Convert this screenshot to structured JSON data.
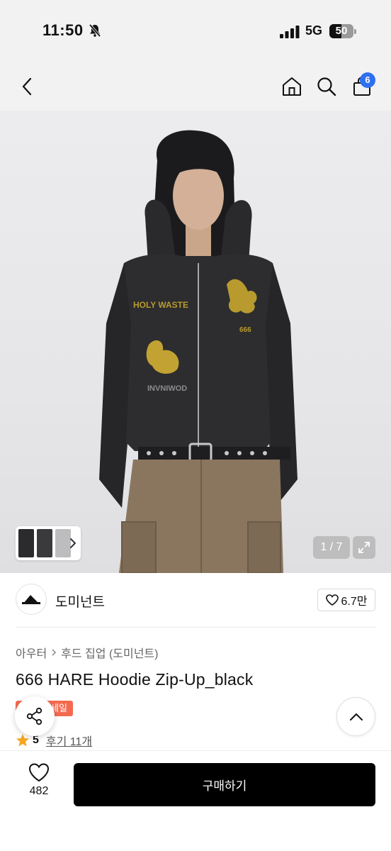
{
  "status_bar": {
    "time": "11:50",
    "network": "5G",
    "battery_level": "50",
    "battery_fraction": 0.5
  },
  "header": {
    "cart_badge": "6"
  },
  "gallery": {
    "counter": "1 / 7",
    "thumbnail_count": 3
  },
  "brand": {
    "name": "도미넌트",
    "like_count": "6.7만"
  },
  "product": {
    "breadcrumb": [
      "아우터",
      "후드 집업 (도미넌트)"
    ],
    "title": "666 HARE Hoodie Zip-Up_black",
    "sale_badge": "세일",
    "rating": "5",
    "reviews": "후기 11개"
  },
  "bottom_bar": {
    "wish_count": "482",
    "buy_label": "구매하기"
  },
  "colors": {
    "accent_blue": "#2f6ff0",
    "sale_red": "#f36a50",
    "star_gold": "#f5a623",
    "primary_black": "#000000"
  }
}
